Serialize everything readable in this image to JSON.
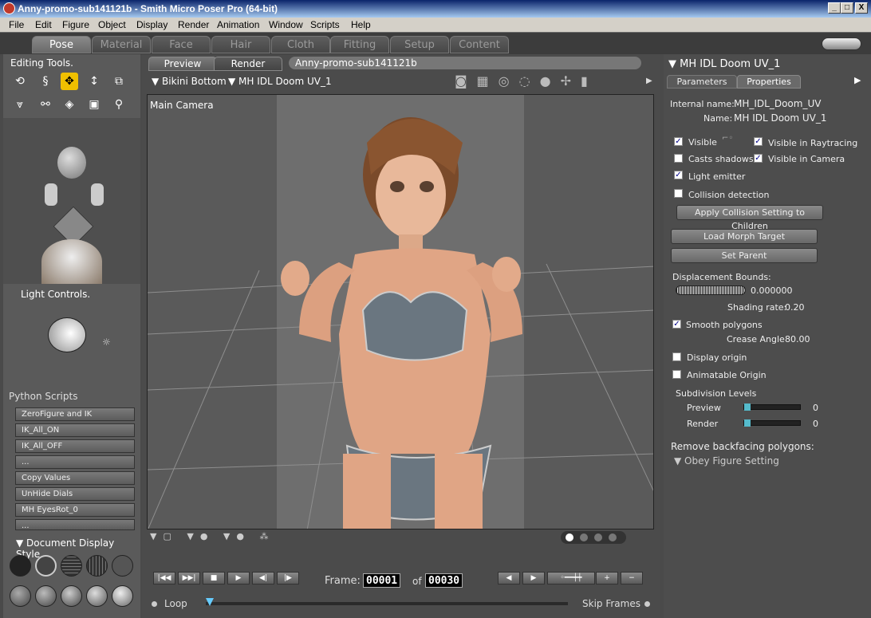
{
  "window": {
    "title": "Anny-promo-sub141121b - Smith Micro Poser Pro  (64-bit)",
    "min": "_",
    "max": "□",
    "close": "X"
  },
  "menu": [
    "File",
    "Edit",
    "Figure",
    "Object",
    "Display",
    "Render",
    "Animation",
    "Window",
    "Scripts",
    "Help"
  ],
  "rooms": [
    "Pose",
    "Material",
    "Face",
    "Hair",
    "Cloth",
    "Fitting",
    "Setup",
    "Content"
  ],
  "left": {
    "editing_title": "Editing Tools.",
    "light_title": "Light Controls.",
    "python_title": "Python Scripts",
    "python_buttons": [
      "ZeroFigure and IK",
      "IK_All_ON",
      "IK_All_OFF",
      "...",
      "Copy Values",
      "UnHide Dials",
      "MH EyesRot_0",
      "..."
    ],
    "doc_display_title": "Document Display Style"
  },
  "viewport": {
    "tabs": [
      "Preview",
      "Render"
    ],
    "doc_name": "Anny-promo-sub141121b",
    "figure_select": "Bikini Bottom",
    "actor_select": "MH IDL Doom UV_1",
    "camera_label": "Main Camera"
  },
  "right": {
    "title": "MH IDL Doom UV_1",
    "tabs": [
      "Parameters",
      "Properties"
    ],
    "internal_name_label": "Internal name:",
    "internal_name": "MH_IDL_Doom_UV",
    "name_label": "Name:",
    "name": "MH IDL Doom UV_1",
    "visible": "Visible",
    "visible_raytracing": "Visible in Raytracing",
    "casts_shadows": "Casts shadows",
    "visible_camera": "Visible in Camera",
    "light_emitter": "Light emitter",
    "collision": "Collision detection",
    "apply_collision": "Apply Collision Setting to Children",
    "load_morph": "Load Morph Target",
    "set_parent": "Set Parent",
    "displacement_label": "Displacement Bounds:",
    "displacement_value": "0.000000",
    "shading_label": "Shading rate:",
    "shading_value": "0.20",
    "smooth": "Smooth polygons",
    "crease_label": "Crease Angle",
    "crease_value": "80.00",
    "display_origin": "Display origin",
    "animatable_origin": "Animatable Origin",
    "subdiv_title": "Subdivision Levels",
    "subdiv_preview_label": "Preview",
    "subdiv_preview": "0",
    "subdiv_render_label": "Render",
    "subdiv_render": "0",
    "backface_label": "Remove backfacing polygons:",
    "backface_value": "Obey Figure Setting"
  },
  "timeline": {
    "frame_label": "Frame:",
    "frame": "00001",
    "of_label": "of",
    "total": "00030",
    "loop": "Loop",
    "skip_frames": "Skip Frames"
  }
}
